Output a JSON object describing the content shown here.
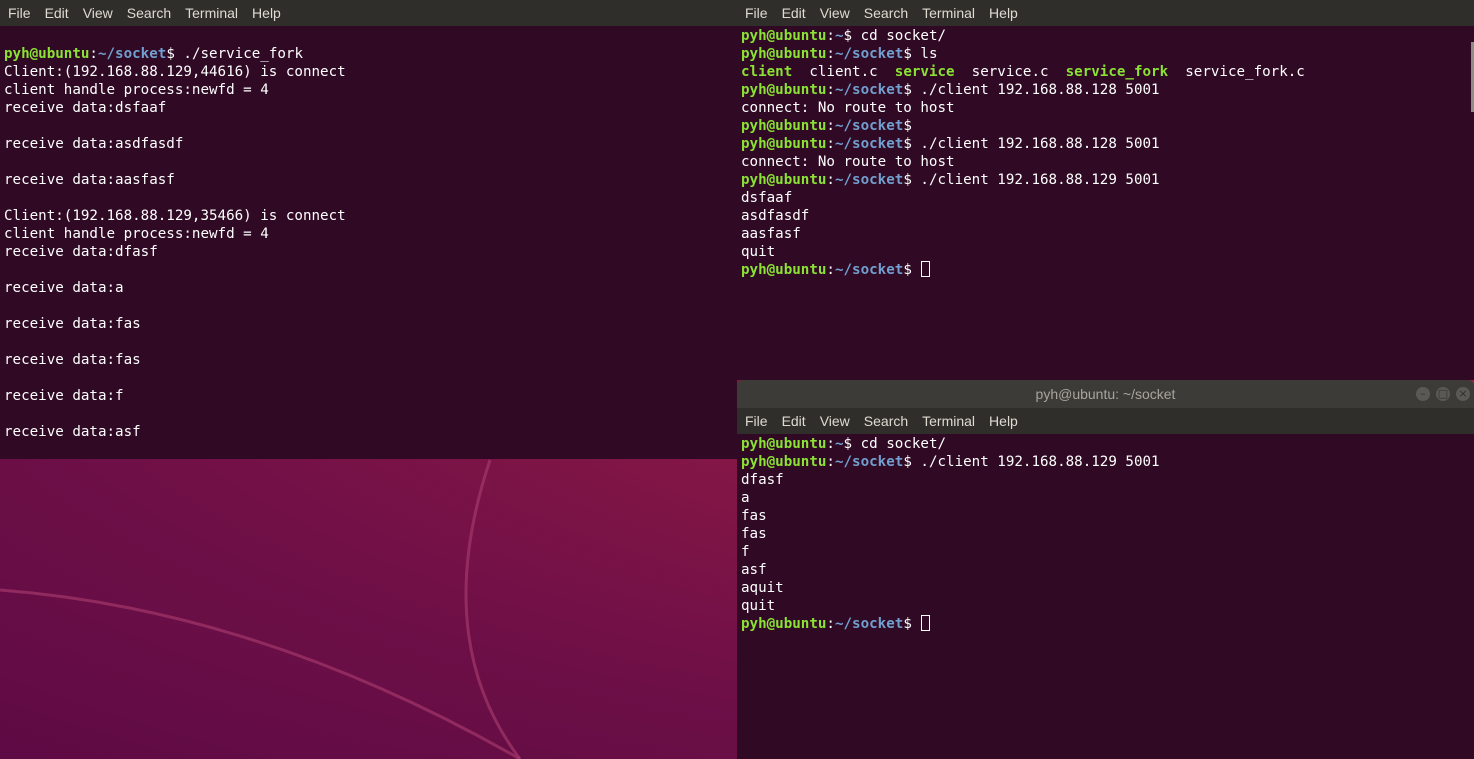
{
  "menu": [
    "File",
    "Edit",
    "View",
    "Search",
    "Terminal",
    "Help"
  ],
  "prompt": {
    "user": "pyh@ubuntu",
    "colon": ":",
    "home": "~",
    "socket": "~/socket",
    "dollar": "$ "
  },
  "server": {
    "lines": [
      {
        "t": "prompt",
        "path": "~/socket",
        "cmd": "./service_fork"
      },
      {
        "t": "text",
        "text": "Client:(192.168.88.129,44616) is connect"
      },
      {
        "t": "text",
        "text": "client handle process:newfd = 4"
      },
      {
        "t": "text",
        "text": "receive data:dsfaaf"
      },
      {
        "t": "text",
        "text": ""
      },
      {
        "t": "text",
        "text": "receive data:asdfasdf"
      },
      {
        "t": "text",
        "text": ""
      },
      {
        "t": "text",
        "text": "receive data:aasfasf"
      },
      {
        "t": "text",
        "text": ""
      },
      {
        "t": "text",
        "text": "Client:(192.168.88.129,35466) is connect"
      },
      {
        "t": "text",
        "text": "client handle process:newfd = 4"
      },
      {
        "t": "text",
        "text": "receive data:dfasf"
      },
      {
        "t": "text",
        "text": ""
      },
      {
        "t": "text",
        "text": "receive data:a"
      },
      {
        "t": "text",
        "text": ""
      },
      {
        "t": "text",
        "text": "receive data:fas"
      },
      {
        "t": "text",
        "text": ""
      },
      {
        "t": "text",
        "text": "receive data:fas"
      },
      {
        "t": "text",
        "text": ""
      },
      {
        "t": "text",
        "text": "receive data:f"
      },
      {
        "t": "text",
        "text": ""
      },
      {
        "t": "text",
        "text": "receive data:asf"
      }
    ]
  },
  "client1": {
    "lines": [
      {
        "t": "prompt",
        "path": "~",
        "cmd": "cd socket/"
      },
      {
        "t": "prompt",
        "path": "~/socket",
        "cmd": "ls"
      },
      {
        "t": "ls",
        "items": [
          {
            "name": "client",
            "exec": true
          },
          {
            "name": "client.c",
            "exec": false
          },
          {
            "name": "service",
            "exec": true
          },
          {
            "name": "service.c",
            "exec": false
          },
          {
            "name": "service_fork",
            "exec": true
          },
          {
            "name": "service_fork.c",
            "exec": false
          }
        ]
      },
      {
        "t": "prompt",
        "path": "~/socket",
        "cmd": "./client 192.168.88.128 5001"
      },
      {
        "t": "text",
        "text": "connect: No route to host"
      },
      {
        "t": "prompt",
        "path": "~/socket",
        "cmd": ""
      },
      {
        "t": "prompt",
        "path": "~/socket",
        "cmd": "./client 192.168.88.128 5001"
      },
      {
        "t": "text",
        "text": "connect: No route to host"
      },
      {
        "t": "prompt",
        "path": "~/socket",
        "cmd": "./client 192.168.88.129 5001"
      },
      {
        "t": "text",
        "text": "dsfaaf"
      },
      {
        "t": "text",
        "text": "asdfasdf"
      },
      {
        "t": "text",
        "text": "aasfasf"
      },
      {
        "t": "text",
        "text": "quit"
      },
      {
        "t": "prompt",
        "path": "~/socket",
        "cmd": "",
        "cursor": true
      }
    ]
  },
  "client2": {
    "title": "pyh@ubuntu: ~/socket",
    "lines": [
      {
        "t": "prompt",
        "path": "~",
        "cmd": "cd socket/"
      },
      {
        "t": "prompt",
        "path": "~/socket",
        "cmd": "./client 192.168.88.129 5001"
      },
      {
        "t": "text",
        "text": "dfasf"
      },
      {
        "t": "text",
        "text": "a"
      },
      {
        "t": "text",
        "text": "fas"
      },
      {
        "t": "text",
        "text": "fas"
      },
      {
        "t": "text",
        "text": "f"
      },
      {
        "t": "text",
        "text": "asf"
      },
      {
        "t": "text",
        "text": "aquit"
      },
      {
        "t": "text",
        "text": "quit"
      },
      {
        "t": "prompt",
        "path": "~/socket",
        "cmd": "",
        "cursor": true
      }
    ]
  },
  "window_buttons": [
    "minimize-icon",
    "maximize-icon",
    "close-icon"
  ],
  "colors": {
    "terminal_bg": "#300a24",
    "menubar_bg": "#2f2e2b",
    "prompt_user": "#8ae234",
    "prompt_path": "#729fcf",
    "exec_file": "#8ae234"
  }
}
